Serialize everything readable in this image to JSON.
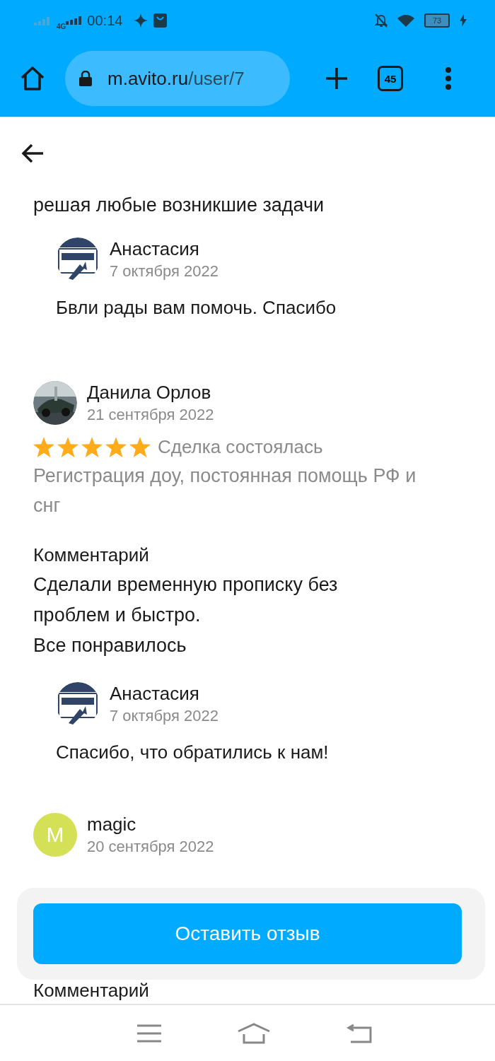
{
  "status_bar": {
    "time": "00:14",
    "network": "4G",
    "battery": "73"
  },
  "browser": {
    "url_host": "m.avito.ru",
    "url_path": "/user/7",
    "tab_count": "45"
  },
  "reviews": [
    {
      "kind": "continuation",
      "text": "решая любые возникшие задачи",
      "reply": {
        "author": "Анастасия",
        "date": "7 октября 2022",
        "text": "Бвли рады вам помочь. Спасибо"
      }
    },
    {
      "kind": "full",
      "author": "Данила Орлов",
      "date": "21 сентября 2022",
      "avatar": {
        "kind": "picture"
      },
      "stars": 5,
      "status": "Сделка состоялась",
      "item": "Регистрация доу, постоянная помощь РФ и снг",
      "comment_label": "Комментарий",
      "comment": [
        "Сделали временную прописку без проблем и быстро.",
        "Все понравилось"
      ],
      "reply": {
        "author": "Анастасия",
        "date": "7 октября 2022",
        "text": "Спасибо, что обратились к нам!"
      }
    },
    {
      "kind": "header",
      "author": "magic",
      "date": "20 сентября 2022",
      "avatar": {
        "kind": "initial",
        "initial": "M",
        "color": "#d4e157"
      },
      "comment_label": "Комментарий"
    }
  ],
  "action_button": "Оставить отзыв"
}
